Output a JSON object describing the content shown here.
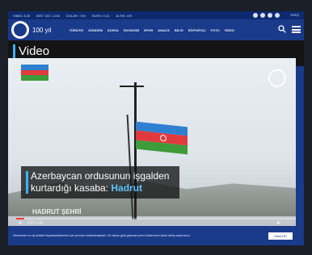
{
  "ticker": {
    "items": [
      "SIMDI: 8.30",
      "BIST 100: 1.234",
      "DOLAR: 7,69",
      "EURO: 9,12",
      "ALTIN: 475"
    ],
    "login": "GİRİŞ"
  },
  "nav": {
    "logo_text": "100 yıl",
    "menu": [
      "TÜRKİYE",
      "GÜNDEM",
      "DÜNYA",
      "EKONOMİ",
      "SPOR",
      "ANALİZ",
      "BİLGİ",
      "RÖPORTAJ",
      "FOTO",
      "VİDEO"
    ]
  },
  "section_title": "Video",
  "video": {
    "caption_line1": "Azerbaycan ordusunun işgalden",
    "caption_line2_prefix": "kurtardığı kasaba: ",
    "caption_line2_highlight": "Hadrut",
    "subcaption": "HADRUT ŞEHRİ",
    "time": "0:00 / 1:45",
    "progress": 0.03
  },
  "cookie": {
    "text": "Sitemizden en iyi şekilde faydalanabilmeniz için çerezler kullanılmaktadır. Bu siteye giriş yaparak çerez kullanımını kabul etmiş sayılırsınız.",
    "button": "Kabul Et"
  },
  "colors": {
    "brand_blue": "#1a3a8a",
    "accent": "#3fb1ff",
    "flag_blue": "#2f7fd0",
    "flag_red": "#e03a3e",
    "flag_green": "#3e9b3a"
  }
}
